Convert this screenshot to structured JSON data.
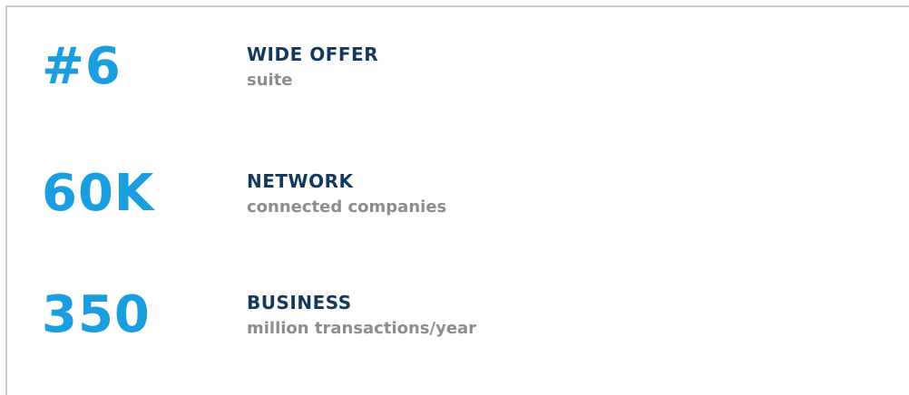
{
  "stats": [
    {
      "value": "#6",
      "heading": "WIDE OFFER",
      "subtitle": "suite"
    },
    {
      "value": "60K",
      "heading": "NETWORK",
      "subtitle": "connected companies"
    },
    {
      "value": "350",
      "heading": "BUSINESS",
      "subtitle": "million transactions/year"
    }
  ],
  "colors": {
    "value": "#1a9ee0",
    "heading": "#14395c",
    "subtitle": "#8a8d91",
    "border": "#c9c9c9"
  }
}
